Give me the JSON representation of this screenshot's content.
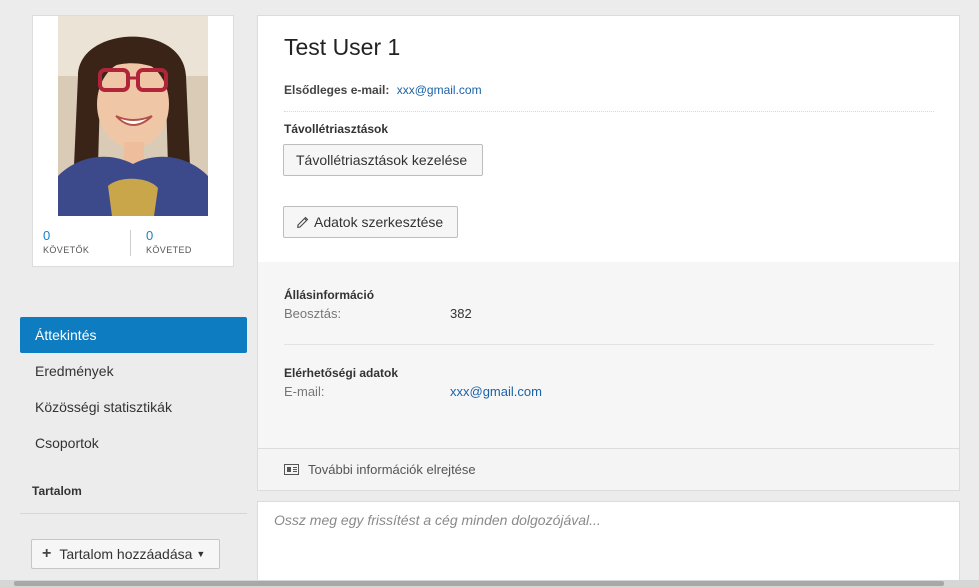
{
  "profile": {
    "followers_count": "0",
    "followers_label": "KÖVETŐK",
    "following_count": "0",
    "following_label": "KÖVETED"
  },
  "nav": {
    "items": [
      {
        "label": "Áttekintés",
        "active": true
      },
      {
        "label": "Eredmények",
        "active": false
      },
      {
        "label": "Közösségi statisztikák",
        "active": false
      },
      {
        "label": "Csoportok",
        "active": false
      }
    ],
    "content_heading": "Tartalom",
    "add_content_label": "Tartalom hozzáadása"
  },
  "main": {
    "user_name": "Test User 1",
    "primary_email_label": "Elsődleges e-mail:",
    "primary_email_value": "xxx@gmail.com",
    "out_of_office_title": "Távollétriasztások",
    "manage_ooo_button": "Távollétriasztások kezelése",
    "edit_data_button": "Adatok szerkesztése",
    "job_info": {
      "heading": "Állásinformáció",
      "title_label": "Beosztás:",
      "title_value": "382"
    },
    "contact_info": {
      "heading": "Elérhetőségi adatok",
      "email_label": "E-mail:",
      "email_value": "xxx@gmail.com"
    },
    "hide_more_info": "További információk elrejtése"
  },
  "update": {
    "placeholder": "Ossz meg egy frissítést a cég minden dolgozójával..."
  },
  "colors": {
    "accent": "#0d7cc1",
    "link": "#1a62a8"
  }
}
